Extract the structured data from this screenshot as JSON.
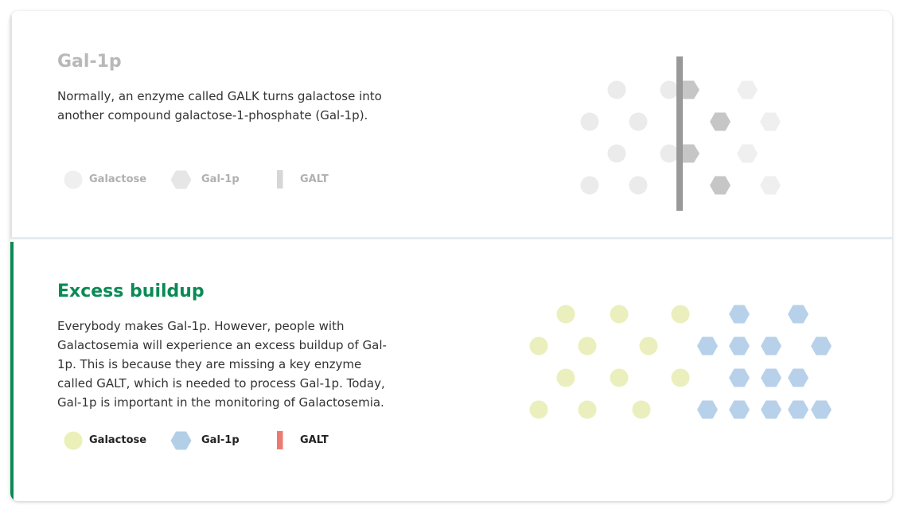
{
  "sections": [
    {
      "title": "Gal-1p",
      "description": "Normally, an enzyme called GALK turns galactose into another compound galactose-1-phosphate (Gal-1p).",
      "legend": [
        {
          "shape": "circle",
          "label": "Galactose",
          "color": "#eeeeee"
        },
        {
          "shape": "hexagon",
          "label": "Gal-1p",
          "color": "#e4e4e4"
        },
        {
          "shape": "bar",
          "label": "GALT",
          "color": "#d9d9d9"
        }
      ],
      "colors": {
        "circle": "#ebebeb",
        "hex_light": "#efefef",
        "hex_dark": "#c8c8c8",
        "enzyme": "#999999",
        "title": "#b8b8b8"
      }
    },
    {
      "title": "Excess buildup",
      "description": "Everybody makes Gal-1p. However, people with Galactosemia will experience an excess buildup of Gal-1p. This is because they are missing a key enzyme called GALT, which is needed to process Gal-1p. Today, Gal-1p is important in the monitoring of Galactosemia.",
      "legend": [
        {
          "shape": "circle",
          "label": "Galactose",
          "color": "#eaf0b8"
        },
        {
          "shape": "hexagon",
          "label": "Gal-1p",
          "color": "#b3cfe8"
        },
        {
          "shape": "bar",
          "label": "GALT",
          "color": "#ec7a70"
        }
      ],
      "colors": {
        "circle": "#ebefbd",
        "hexagon": "#b8d1ea",
        "accent": "#0a8a55"
      }
    }
  ]
}
